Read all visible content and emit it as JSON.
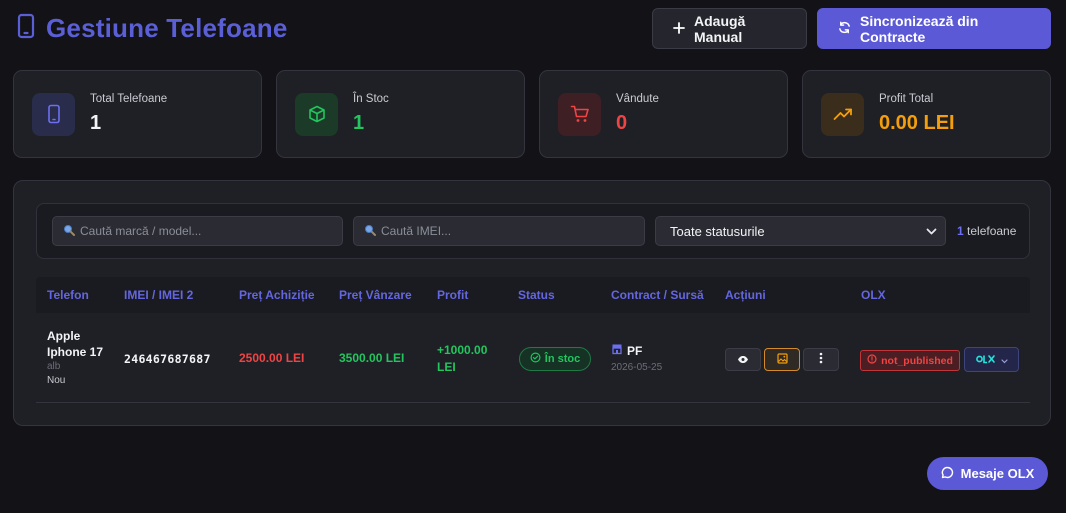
{
  "header": {
    "title": "Gestiune Telefoane",
    "add_button": "Adaugă Manual",
    "sync_button": "Sincronizează din Contracte"
  },
  "stats": [
    {
      "label": "Total Telefoane",
      "value": "1",
      "icon": "phone-icon",
      "color": "#e5e7eb"
    },
    {
      "label": "În Stoc",
      "value": "1",
      "icon": "box-icon",
      "color": "#22c55e"
    },
    {
      "label": "Vândute",
      "value": "0",
      "icon": "cart-icon",
      "color": "#ef4444"
    },
    {
      "label": "Profit Total",
      "value": "0.00 LEI",
      "icon": "trending-up-icon",
      "color": "#f59e0b"
    }
  ],
  "filters": {
    "search_brand_placeholder": "Caută marcă / model...",
    "search_imei_placeholder": "Caută IMEI...",
    "status_select": "Toate statusurile",
    "count_number": "1",
    "count_label": "telefoane"
  },
  "table": {
    "columns": [
      "Telefon",
      "IMEI / IMEI 2",
      "Preț Achiziție",
      "Preț Vânzare",
      "Profit",
      "Status",
      "Contract / Sursă",
      "Acțiuni",
      "OLX"
    ],
    "rows": [
      {
        "brand": "Apple",
        "model": "Iphone 17",
        "color": "alb",
        "condition": "Nou",
        "imei": "246467687687",
        "purchase_price": "2500.00 LEI",
        "sale_price": "3500.00 LEI",
        "profit_value": "+1000.00",
        "profit_unit": "LEI",
        "status": "În stoc",
        "contract_type": "PF",
        "contract_date": "2026-05-25",
        "olx_status": "not_published"
      }
    ]
  },
  "chat_button": "Mesaje OLX",
  "colors": {
    "accent": "#5b59d6",
    "background": "#121217",
    "card": "#1f2026",
    "success": "#22c55e",
    "danger": "#ef4444",
    "warning": "#f59e0b"
  }
}
